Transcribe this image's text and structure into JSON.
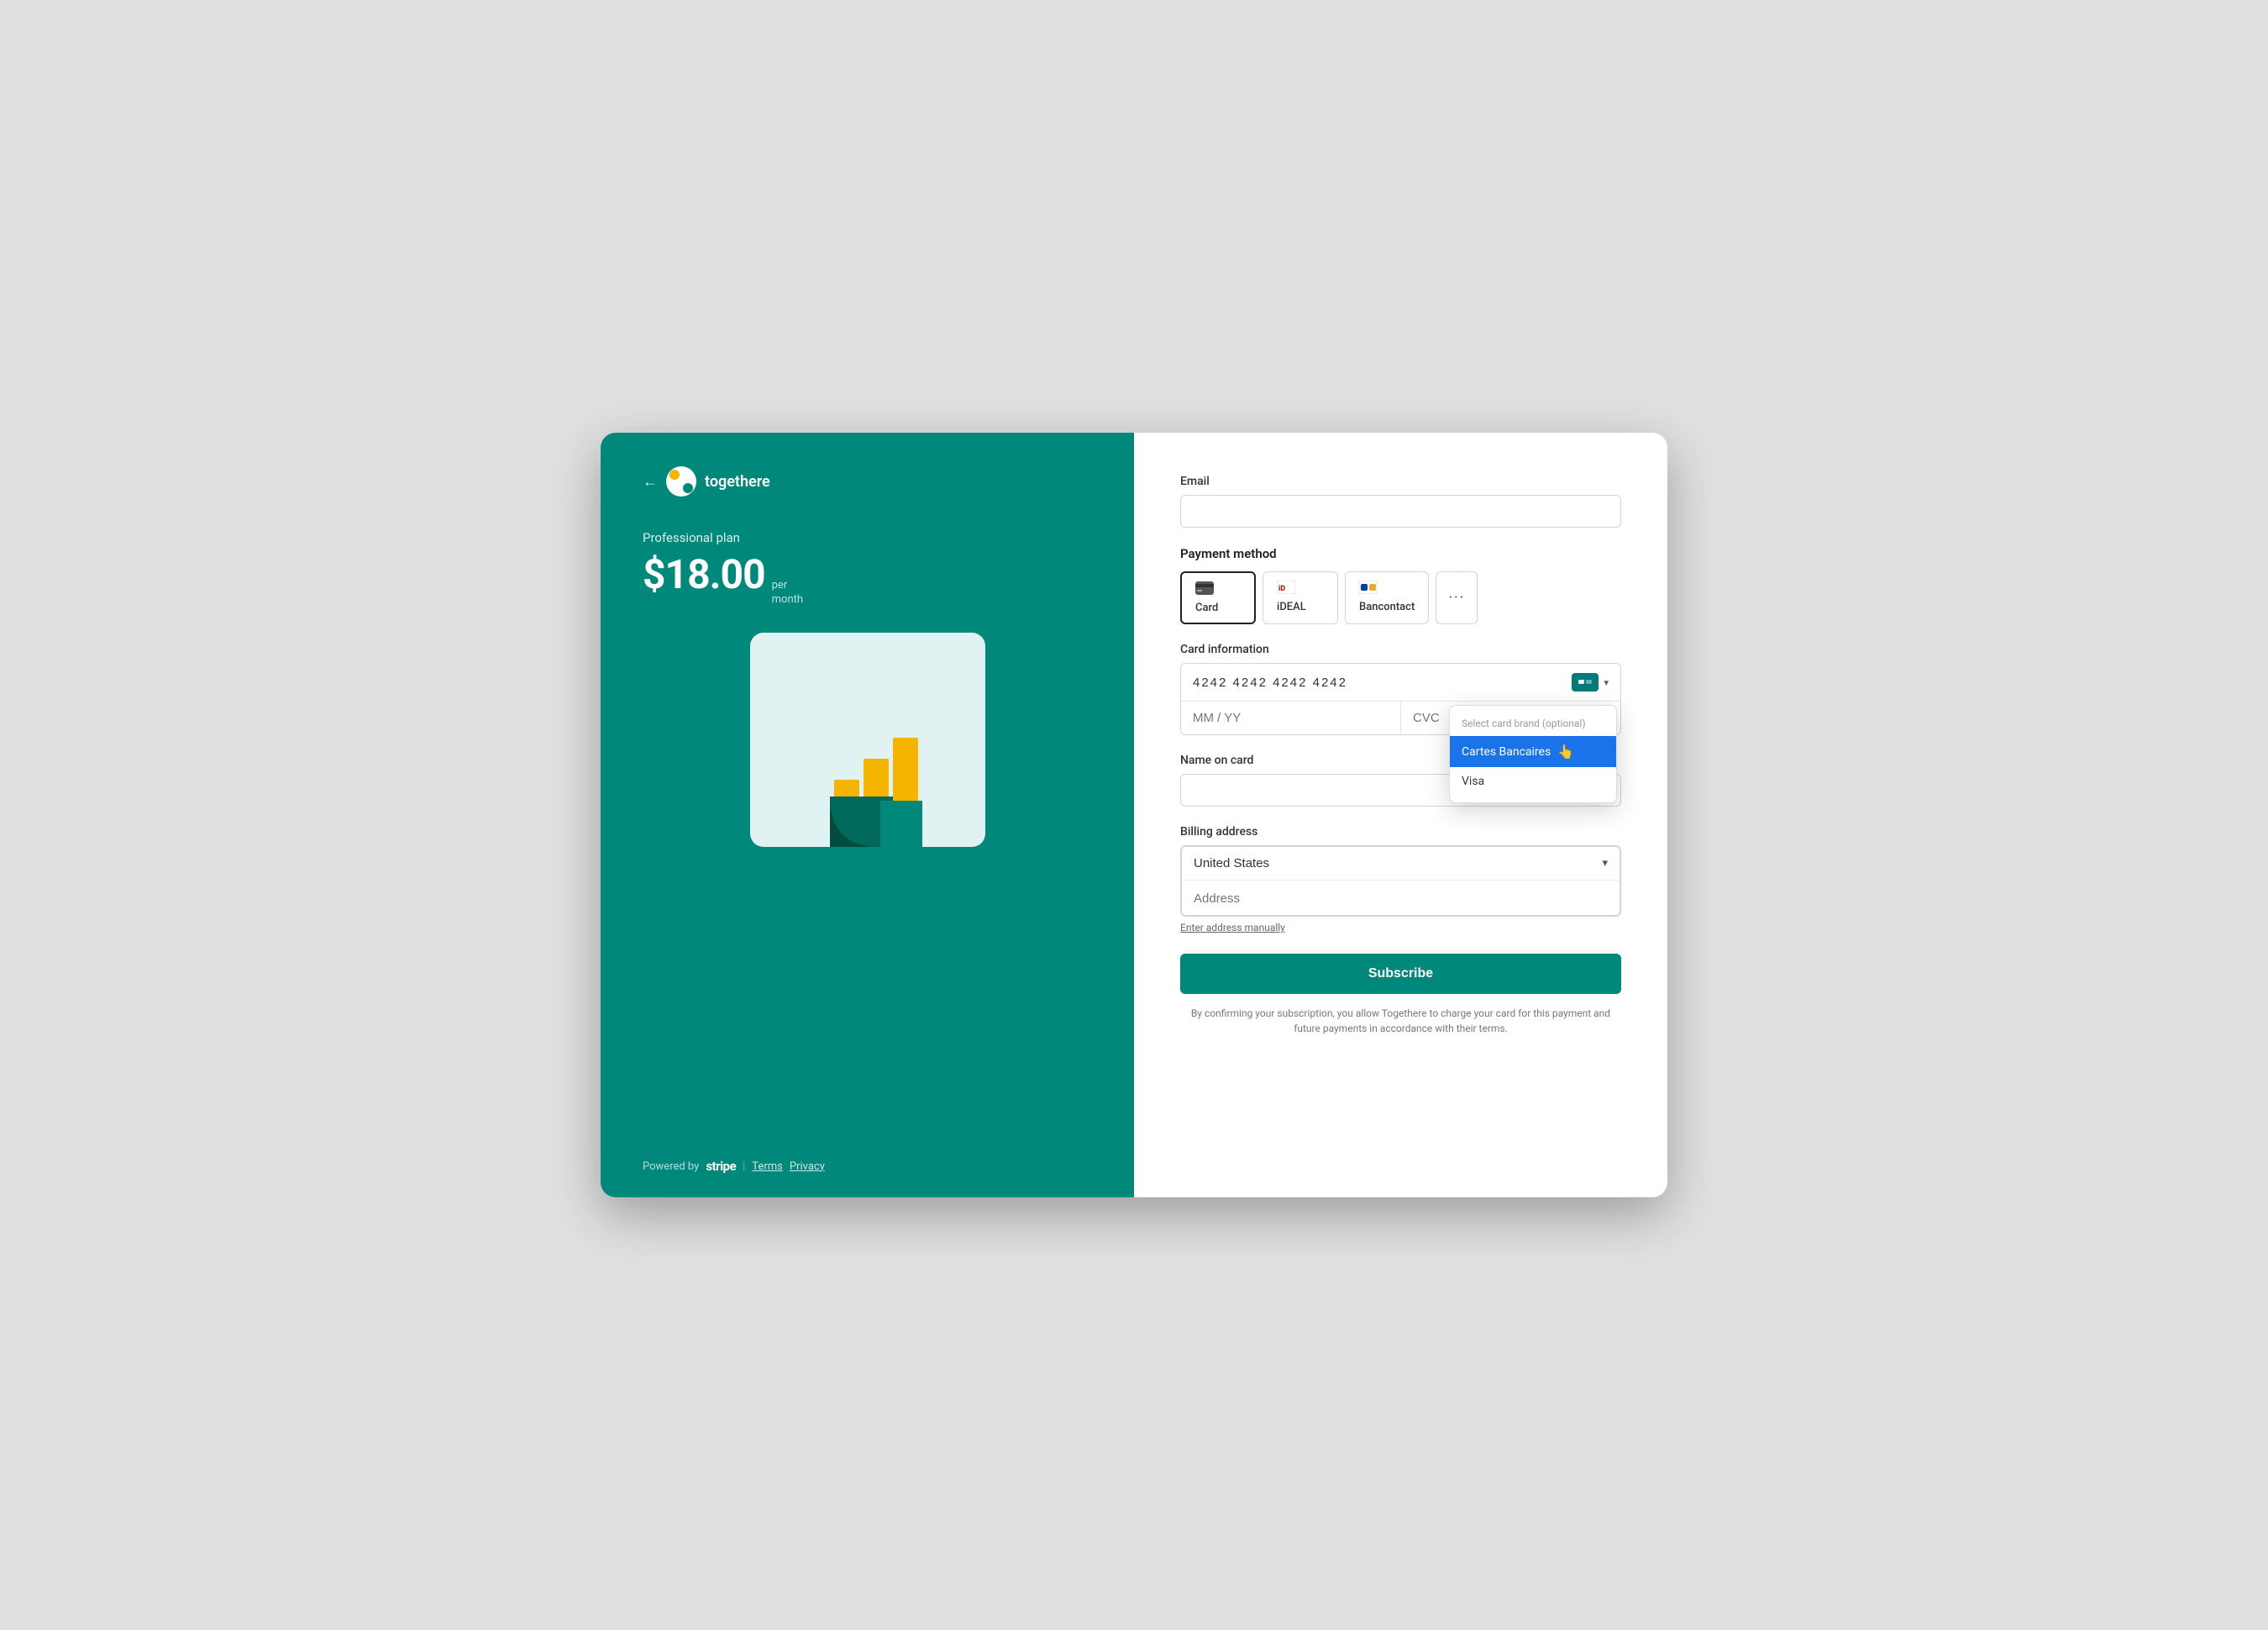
{
  "app": {
    "company_name": "togethere",
    "back_label": "←"
  },
  "left_panel": {
    "plan_name": "Professional plan",
    "price": "$18.00",
    "price_per": "per",
    "price_period": "month",
    "footer": {
      "powered_by": "Powered by",
      "stripe": "stripe",
      "divider": "|",
      "terms": "Terms",
      "privacy": "Privacy"
    }
  },
  "right_panel": {
    "email": {
      "label": "Email",
      "placeholder": "",
      "value": ""
    },
    "payment_method": {
      "label": "Payment method",
      "tabs": [
        {
          "id": "card",
          "label": "Card",
          "icon": "💳",
          "active": true
        },
        {
          "id": "ideal",
          "label": "iDEAL",
          "icon": "iDEAL",
          "active": false
        },
        {
          "id": "bancontact",
          "label": "Bancontact",
          "icon": "🔵",
          "active": false
        },
        {
          "id": "more",
          "label": "···",
          "icon": "···",
          "active": false
        }
      ]
    },
    "card_info": {
      "label": "Card information",
      "card_number": "4242 4242 4242 4242",
      "expiry_placeholder": "MM / YY",
      "cvc_placeholder": "CVC"
    },
    "card_brand_dropdown": {
      "title": "Select card brand (optional)",
      "options": [
        {
          "id": "cartes_bancaires",
          "label": "Cartes Bancaires",
          "selected": true
        },
        {
          "id": "visa",
          "label": "Visa",
          "selected": false
        }
      ]
    },
    "name_on_card": {
      "label": "Name on card",
      "placeholder": "",
      "value": ""
    },
    "billing_address": {
      "label": "Billing address",
      "country": "United States",
      "address_placeholder": "Address",
      "enter_manually": "Enter address manually"
    },
    "subscribe_button": "Subscribe",
    "terms_text": "By confirming your subscription, you allow Togethere to charge your card for this payment and future payments in accordance with their terms."
  }
}
